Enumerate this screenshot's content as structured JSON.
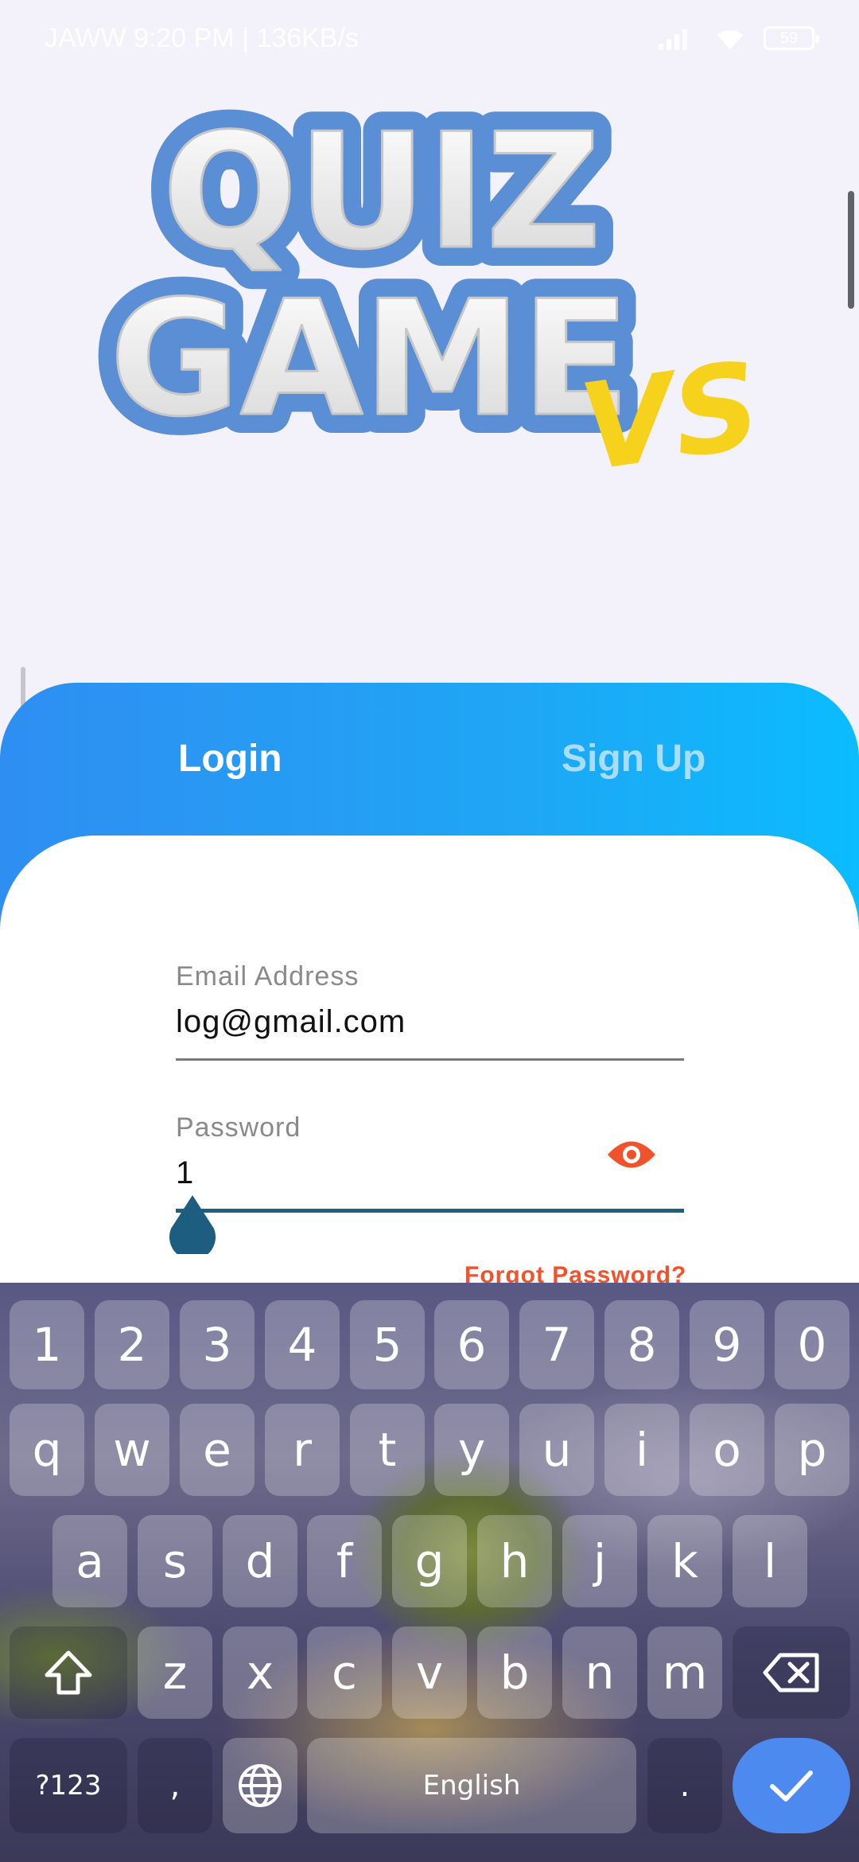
{
  "status_bar": {
    "left_text": "JAWW  9:20 PM | 136KB/s",
    "battery": "59"
  },
  "logo": {
    "line1": "QUIZ",
    "line2": "GAME",
    "suffix": "VS"
  },
  "tabs": [
    {
      "label": "Login",
      "active": true
    },
    {
      "label": "Sign Up",
      "active": false
    }
  ],
  "form": {
    "email": {
      "label": "Email Address",
      "value": "log@gmail.com"
    },
    "password": {
      "label": "Password",
      "value": "1"
    },
    "forgot_label": "Forgot Password?"
  },
  "keyboard": {
    "number_row": [
      "1",
      "2",
      "3",
      "4",
      "5",
      "6",
      "7",
      "8",
      "9",
      "0"
    ],
    "row1": [
      "q",
      "w",
      "e",
      "r",
      "t",
      "y",
      "u",
      "i",
      "o",
      "p"
    ],
    "row2": [
      "a",
      "s",
      "d",
      "f",
      "g",
      "h",
      "j",
      "k",
      "l"
    ],
    "row3": [
      "z",
      "x",
      "c",
      "v",
      "b",
      "n",
      "m"
    ],
    "symbols_label": "?123",
    "comma": ",",
    "space_label": "English",
    "period": "."
  },
  "colors": {
    "accent_blue": "#2f8ef2",
    "accent_cyan": "#0bbcfe",
    "orange": "#f0532c",
    "cursor_teal": "#1f5f80",
    "enter_blue": "#4d8af0"
  }
}
